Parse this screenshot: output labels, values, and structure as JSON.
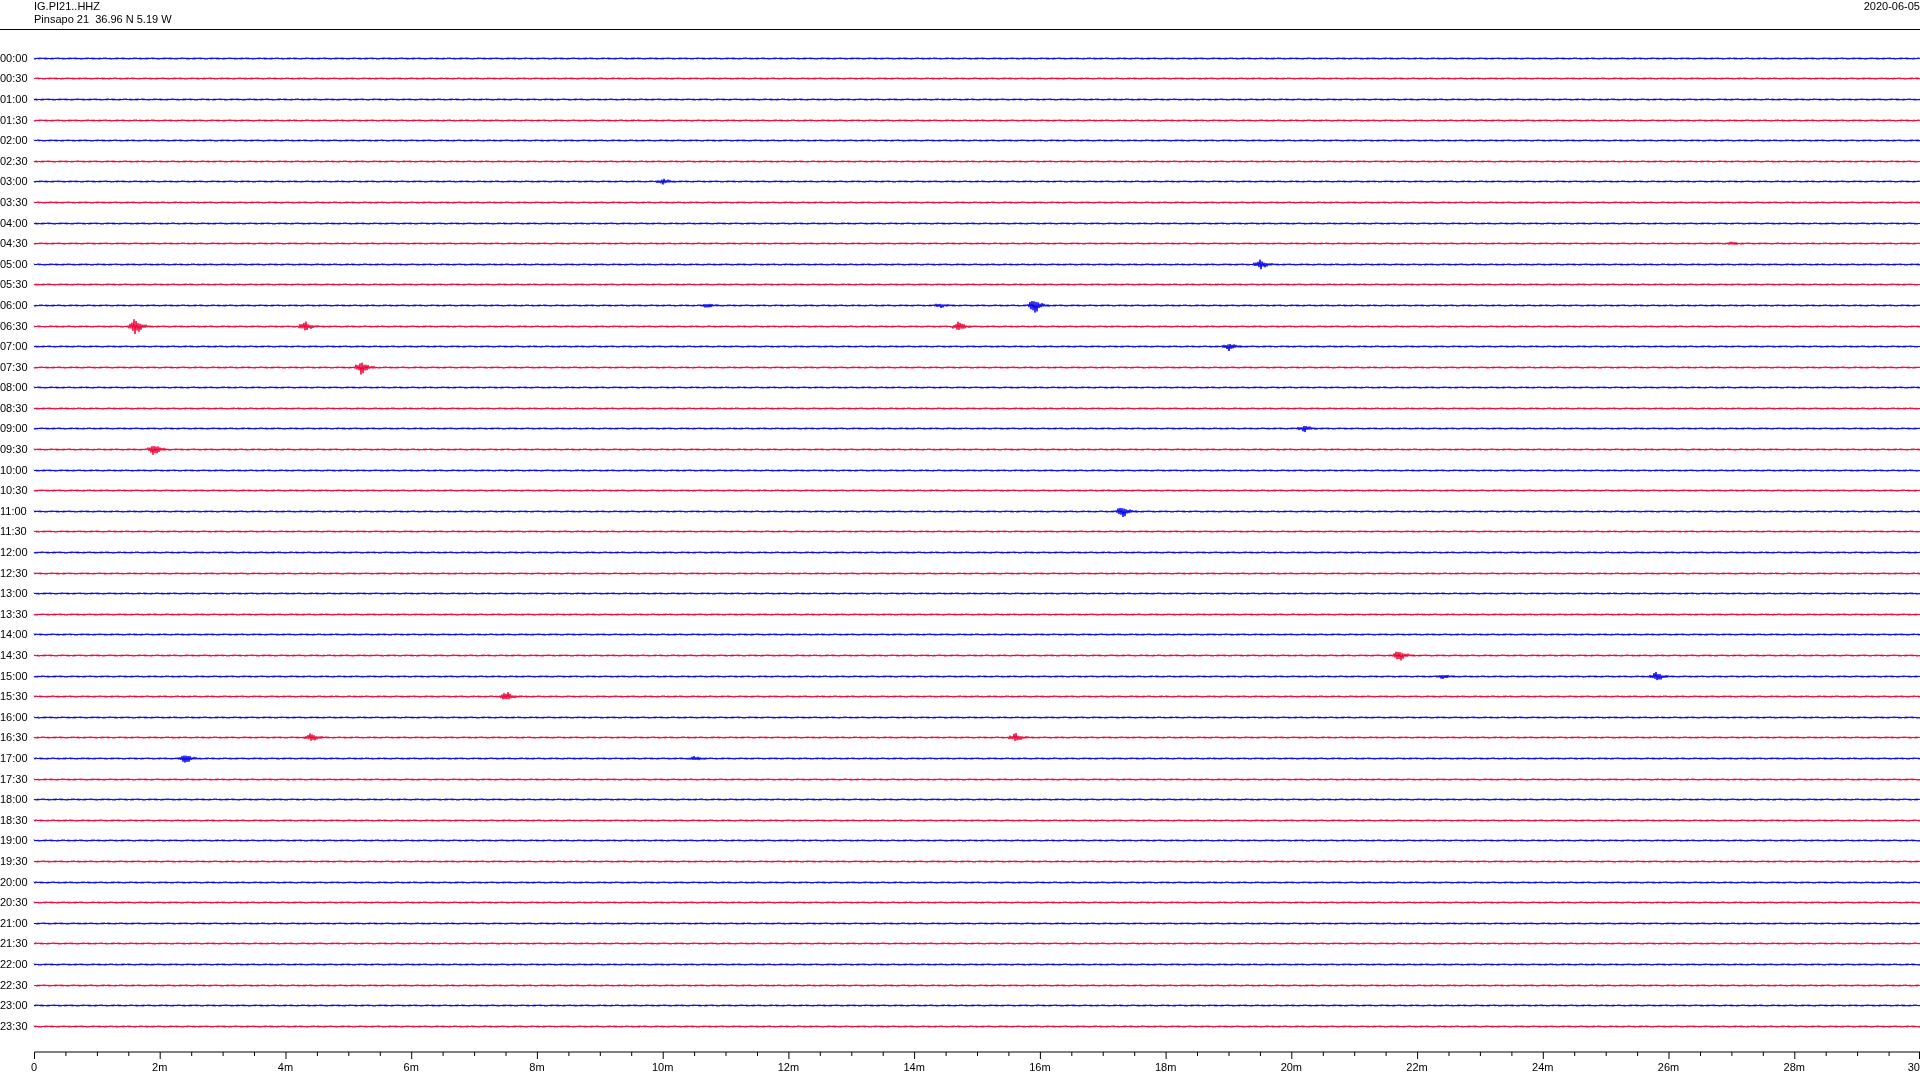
{
  "header": {
    "channel": "IG.PI21..HHZ",
    "station": "Pinsapo 21  36.96 N 5.19 W",
    "date": "2020-06-05"
  },
  "traces": [
    {
      "label": "00:00",
      "color": "#0000ee"
    },
    {
      "label": "00:30",
      "color": "#ee0033"
    },
    {
      "label": "01:00",
      "color": "#0000ee"
    },
    {
      "label": "01:30",
      "color": "#ee0033"
    },
    {
      "label": "02:00",
      "color": "#0000ee"
    },
    {
      "label": "02:30",
      "color": "#ee0033"
    },
    {
      "label": "03:00",
      "color": "#0000ee"
    },
    {
      "label": "03:30",
      "color": "#ee0033"
    },
    {
      "label": "04:00",
      "color": "#0000ee"
    },
    {
      "label": "04:30",
      "color": "#ee0033"
    },
    {
      "label": "05:00",
      "color": "#0000ee"
    },
    {
      "label": "05:30",
      "color": "#ee0033"
    },
    {
      "label": "06:00",
      "color": "#0000ee"
    },
    {
      "label": "06:30",
      "color": "#ee0033"
    },
    {
      "label": "07:00",
      "color": "#0000ee"
    },
    {
      "label": "07:30",
      "color": "#ee0033"
    },
    {
      "label": "08:00",
      "color": "#0000ee"
    },
    {
      "label": "08:30",
      "color": "#ee0033"
    },
    {
      "label": "09:00",
      "color": "#0000ee"
    },
    {
      "label": "09:30",
      "color": "#ee0033"
    },
    {
      "label": "10:00",
      "color": "#0000ee"
    },
    {
      "label": "10:30",
      "color": "#ee0033"
    },
    {
      "label": "11:00",
      "color": "#0000ee"
    },
    {
      "label": "11:30",
      "color": "#ee0033"
    },
    {
      "label": "12:00",
      "color": "#0000ee"
    },
    {
      "label": "12:30",
      "color": "#ee0033"
    },
    {
      "label": "13:00",
      "color": "#0000ee"
    },
    {
      "label": "13:30",
      "color": "#ee0033"
    },
    {
      "label": "14:00",
      "color": "#0000ee"
    },
    {
      "label": "14:30",
      "color": "#ee0033"
    },
    {
      "label": "15:00",
      "color": "#0000ee"
    },
    {
      "label": "15:30",
      "color": "#ee0033"
    },
    {
      "label": "16:00",
      "color": "#0000ee"
    },
    {
      "label": "16:30",
      "color": "#ee0033"
    },
    {
      "label": "17:00",
      "color": "#0000ee"
    },
    {
      "label": "17:30",
      "color": "#ee0033"
    },
    {
      "label": "18:00",
      "color": "#0000ee"
    },
    {
      "label": "18:30",
      "color": "#ee0033"
    },
    {
      "label": "19:00",
      "color": "#0000ee"
    },
    {
      "label": "19:30",
      "color": "#ee0033"
    },
    {
      "label": "20:00",
      "color": "#0000ee"
    },
    {
      "label": "20:30",
      "color": "#ee0033"
    },
    {
      "label": "21:00",
      "color": "#0000ee"
    },
    {
      "label": "21:30",
      "color": "#ee0033"
    },
    {
      "label": "22:00",
      "color": "#0000ee"
    },
    {
      "label": "22:30",
      "color": "#ee0033"
    },
    {
      "label": "23:00",
      "color": "#0000ee"
    },
    {
      "label": "23:30",
      "color": "#ee0033"
    }
  ],
  "time_axis": {
    "labels": [
      "0",
      "2m",
      "4m",
      "6m",
      "8m",
      "10m",
      "12m",
      "14m",
      "16m",
      "18m",
      "20m",
      "22m",
      "24m",
      "26m",
      "28m",
      "30"
    ]
  }
}
